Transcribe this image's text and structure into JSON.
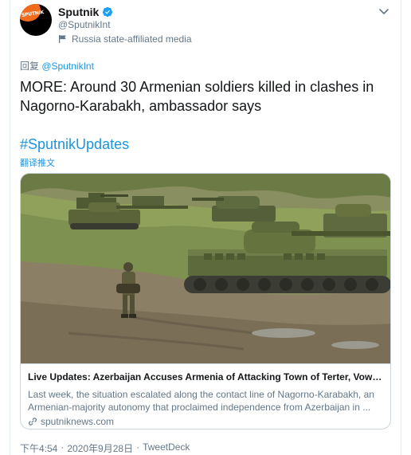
{
  "author": {
    "display_name": "Sputnik",
    "handle": "@SputnikInt",
    "affiliation": "Russia state-affiliated media",
    "avatar_text": "SPUTNIK",
    "verified_icon": "verified-badge-icon"
  },
  "reply": {
    "prefix": "回复",
    "to_handle": "@SputnikInt"
  },
  "tweet": {
    "text": "MORE: Around 30 Armenian soldiers killed in clashes in Nagorno-Karabakh, ambassador says",
    "hashtag": "#SputnikUpdates",
    "translate_label": "翻译推文"
  },
  "link_card": {
    "title": "Live Updates: Azerbaijan Accuses Armenia of Attacking Town of Terter, Vows to ...",
    "description": "Last week, the situation escalated along the contact line of Nagorno-Karabakh, an Armenian-majority autonomy that proclaimed independence from Azerbaijan in ...",
    "domain": "sputniknews.com",
    "image_alt": "tanks-and-soldier-photo"
  },
  "footer": {
    "time": "下午4:54",
    "separator": "·",
    "date": "2020年9月28日",
    "separator2": "·",
    "source": "TweetDeck"
  },
  "colors": {
    "accent": "#1b95e0",
    "text": "#14171a",
    "muted": "#657786",
    "brand_orange": "#f26b1d"
  }
}
